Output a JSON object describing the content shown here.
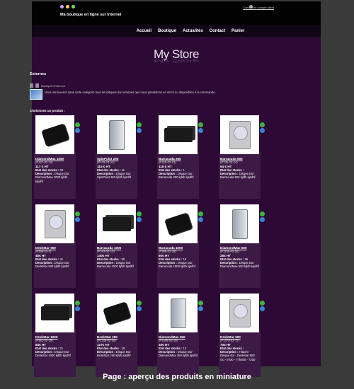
{
  "header": {
    "tagline": "Ma boutique en ligne sur Internet",
    "login_link": "Connexion compte client",
    "dot_colors": [
      "#d4a0ff",
      "#ffd24a",
      "#7ad96a"
    ]
  },
  "nav": {
    "items": [
      "Accueil",
      "Boutique",
      "Actualités",
      "Contact",
      "Panier"
    ]
  },
  "logo": {
    "text": "My Store"
  },
  "section": {
    "title": "Externes",
    "breadcrumb": "Boutique>Externes",
    "description": "Vous retrouverez dans cette catégorie tous les disques dur externes que nous possédons en stock ou disponibles à la commande.",
    "choose_label": "Choisissez un produit :"
  },
  "labels": {
    "stock": "Etat des stocks :",
    "description": "Description :"
  },
  "products": [
    {
      "name": "DiamondMax 1000",
      "ref": "(P227-02-20)",
      "price": "117 €  HT",
      "stock": "28",
      "desc": "Disque Dur DiamondMax 1000 kjfdh kjsdhf",
      "image": "external-black-drive"
    },
    {
      "name": "SpinPoint 250",
      "ref": "(P478-03-22)",
      "price": "115 €  HT",
      "stock": "41",
      "desc": "Disque Dur SpinPoint 250 kjfdh kjsdhf",
      "image": "silver-tower-drive"
    },
    {
      "name": "Barracuda 250",
      "ref": "(P348-02-23)",
      "price": "118 €  HT",
      "stock": "1",
      "desc": "Disque Dur Barracuda 250 kjfdh kjsdhf",
      "image": "black-box-drive"
    },
    {
      "name": "Barracuda 500",
      "ref": "(P236-02-24)",
      "price": "64 €  HT",
      "stock": "",
      "desc": "Disque Dur Barracuda 500 kjfdh kjsdhf",
      "image": "internal-hdd"
    },
    {
      "name": "DeskStar 500",
      "ref": "(P496-02-2)",
      "price": "48€  HT",
      "stock": "41",
      "desc": "Disque Dur DeskStar 500 kjfdh kjsdhf",
      "image": "internal-hdd"
    },
    {
      "name": "Barracuda 1000",
      "ref": "(P183-02-13)",
      "price": "140€  HT",
      "stock": "50",
      "desc": "Disque Dur Barracuda 1000 kjfdh kjsdhf",
      "image": "black-box-drive"
    },
    {
      "name": "Barracuda 1000",
      "ref": "(P368-02-29)",
      "price": "80€  HT",
      "stock": "10",
      "desc": "Disque Dur Barracuda 1000 kjfdh kjsdhf",
      "image": "external-black-drive"
    },
    {
      "name": "DiamondMax 500",
      "ref": "(P1105-02-28)",
      "price": "28€  HT",
      "stock": "39",
      "desc": "Disque Dur DiamondMax 500 kjfdh kjsdhf",
      "image": "silver-tower-drive"
    },
    {
      "name": "DeskStar 1000",
      "ref": "(P361-02-18)",
      "price": "84€  HT",
      "stock": "21",
      "desc": "Disque Dur DeskStar 1000 kjfdh kjsdhf",
      "image": "black-box-drive"
    },
    {
      "name": "DeskStar 250",
      "ref": "(P1148-02-16)",
      "price": "127€  HT",
      "stock": "19",
      "desc": "Disque Dur DeskStar 250 kjfdh kjsdhf",
      "image": "external-black-drive"
    },
    {
      "name": "DiamondMax 250",
      "ref": "(P1499-02-19)",
      "price": "40€  HT",
      "stock": "12",
      "desc": "Disque Dur DiamondMax 250 kjfdh kjsdhf",
      "image": "silver-tower-drive"
    },
    {
      "name": "DeskStar 500",
      "ref": "(P1470-02-17)",
      "price": "70€  HT",
      "stock": "",
      "desc": "Hitachi - Disque dur - Deskstar 500 Go - 8 Mo - T7k500 - 7200",
      "image": "internal-hdd"
    }
  ],
  "caption": "Page : aperçu des produits en miniature"
}
